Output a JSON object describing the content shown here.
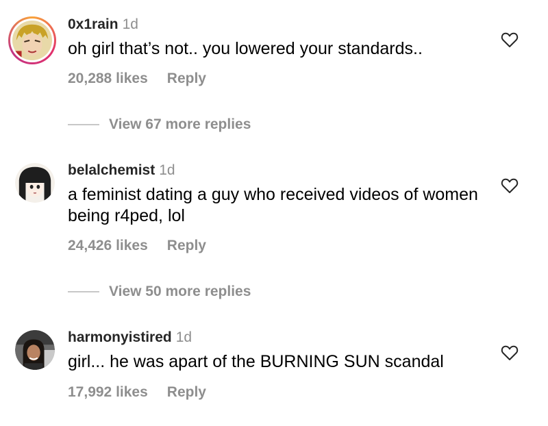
{
  "comments": [
    {
      "username": "0x1rain",
      "time": "1d",
      "text": "oh girl that’s not.. you lowered your standards..",
      "likes": "20,288 likes",
      "reply": "Reply",
      "view_more": "View 67 more replies",
      "avatar_icon": "anime-avatar-icon",
      "has_story_ring": true
    },
    {
      "username": "belalchemist",
      "time": "1d",
      "text": "a feminist dating a guy who received videos of women being r4ped, lol",
      "likes": "24,426 likes",
      "reply": "Reply",
      "view_more": "View 50 more replies",
      "avatar_icon": "anime-avatar-icon",
      "has_story_ring": false
    },
    {
      "username": "harmonyistired",
      "time": "1d",
      "text": "girl... he was apart of the BURNING SUN scandal",
      "likes": "17,992 likes",
      "reply": "Reply",
      "avatar_icon": "profile-photo-icon",
      "has_story_ring": false
    }
  ],
  "colors": {
    "secondary_text": "#8e8e8e",
    "divider": "#c7c7c7",
    "ring_gradient": [
      "#f9a33a",
      "#e1306c",
      "#c13584"
    ]
  }
}
